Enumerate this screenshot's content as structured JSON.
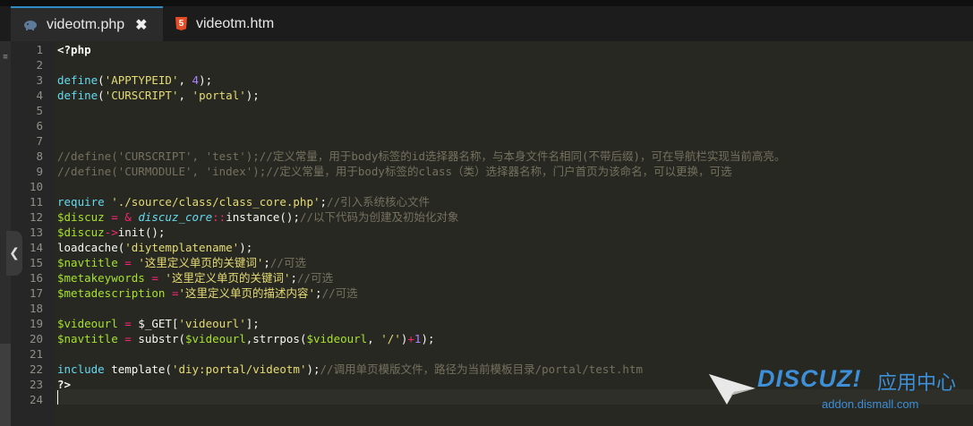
{
  "tabs": [
    {
      "label": "videotm.php",
      "icon": "php-elephant-icon",
      "active": true
    },
    {
      "label": "videotm.htm",
      "icon": "html5-icon",
      "active": false
    }
  ],
  "tab_close_symbol": "✖",
  "html5_letter": "5",
  "side_mark": "≡",
  "collapse_symbol": "❮",
  "line_numbers": [
    "1",
    "2",
    "3",
    "4",
    "5",
    "6",
    "7",
    "8",
    "9",
    "10",
    "11",
    "12",
    "13",
    "14",
    "15",
    "16",
    "17",
    "18",
    "19",
    "20",
    "21",
    "22",
    "23",
    "24"
  ],
  "code": [
    [
      {
        "t": "<?php",
        "c": "b"
      }
    ],
    [],
    [
      {
        "t": "define",
        "c": "kw"
      },
      {
        "t": "(",
        "c": "pl"
      },
      {
        "t": "'APPTYPEID'",
        "c": "str"
      },
      {
        "t": ", ",
        "c": "pl"
      },
      {
        "t": "4",
        "c": "num"
      },
      {
        "t": ");",
        "c": "pl"
      }
    ],
    [
      {
        "t": "define",
        "c": "kw"
      },
      {
        "t": "(",
        "c": "pl"
      },
      {
        "t": "'CURSCRIPT'",
        "c": "str"
      },
      {
        "t": ", ",
        "c": "pl"
      },
      {
        "t": "'portal'",
        "c": "str"
      },
      {
        "t": ");",
        "c": "pl"
      }
    ],
    [],
    [],
    [],
    [
      {
        "t": "//define('CURSCRIPT', 'test');//定义常量，用于body标签的id选择器名称，与本身文件名相同(不带后缀)，可在导航栏实现当前高亮。",
        "c": "cm"
      }
    ],
    [
      {
        "t": "//define('CURMODULE', 'index');//定义常量，用于body标签的class（类）选择器名称，门户首页为该命名，可以更换，可选",
        "c": "cm"
      }
    ],
    [],
    [
      {
        "t": "require",
        "c": "kw"
      },
      {
        "t": " ",
        "c": "pl"
      },
      {
        "t": "'./source/class/class_core.php'",
        "c": "str"
      },
      {
        "t": ";",
        "c": "pl"
      },
      {
        "t": "//引入系统核心文件",
        "c": "cm"
      }
    ],
    [
      {
        "t": "$discuz",
        "c": "var"
      },
      {
        "t": " = ",
        "c": "op"
      },
      {
        "t": "& ",
        "c": "op"
      },
      {
        "t": "discuz_core",
        "c": "it"
      },
      {
        "t": "::",
        "c": "op"
      },
      {
        "t": "instance();",
        "c": "pl"
      },
      {
        "t": "//以下代码为创建及初始化对象",
        "c": "cm"
      }
    ],
    [
      {
        "t": "$discuz",
        "c": "var"
      },
      {
        "t": "->",
        "c": "op"
      },
      {
        "t": "init();",
        "c": "pl"
      }
    ],
    [
      {
        "t": "loadcache(",
        "c": "pl"
      },
      {
        "t": "'diytemplatename'",
        "c": "str"
      },
      {
        "t": ");",
        "c": "pl"
      }
    ],
    [
      {
        "t": "$navtitle",
        "c": "var"
      },
      {
        "t": " = ",
        "c": "op"
      },
      {
        "t": "'这里定义单页的关键词'",
        "c": "str"
      },
      {
        "t": ";",
        "c": "pl"
      },
      {
        "t": "//可选",
        "c": "cm"
      }
    ],
    [
      {
        "t": "$metakeywords",
        "c": "var"
      },
      {
        "t": " = ",
        "c": "op"
      },
      {
        "t": "'这里定义单页的关键词'",
        "c": "str"
      },
      {
        "t": ";",
        "c": "pl"
      },
      {
        "t": "//可选",
        "c": "cm"
      }
    ],
    [
      {
        "t": "$metadescription",
        "c": "var"
      },
      {
        "t": " =",
        "c": "op"
      },
      {
        "t": "'这里定义单页的描述内容'",
        "c": "str"
      },
      {
        "t": ";",
        "c": "pl"
      },
      {
        "t": "//可选",
        "c": "cm"
      }
    ],
    [],
    [
      {
        "t": "$videourl",
        "c": "var"
      },
      {
        "t": " = ",
        "c": "op"
      },
      {
        "t": "$_GET[",
        "c": "pl"
      },
      {
        "t": "'videourl'",
        "c": "str"
      },
      {
        "t": "];",
        "c": "pl"
      }
    ],
    [
      {
        "t": "$navtitle",
        "c": "var"
      },
      {
        "t": " = ",
        "c": "op"
      },
      {
        "t": "substr(",
        "c": "pl"
      },
      {
        "t": "$videourl",
        "c": "var"
      },
      {
        "t": ",strrpos(",
        "c": "pl"
      },
      {
        "t": "$videourl",
        "c": "var"
      },
      {
        "t": ", ",
        "c": "pl"
      },
      {
        "t": "'/'",
        "c": "str"
      },
      {
        "t": ")",
        "c": "pl"
      },
      {
        "t": "+",
        "c": "op"
      },
      {
        "t": "1",
        "c": "num"
      },
      {
        "t": ");",
        "c": "pl"
      }
    ],
    [],
    [
      {
        "t": "include",
        "c": "kw"
      },
      {
        "t": " template(",
        "c": "pl"
      },
      {
        "t": "'diy:portal/videotm'",
        "c": "str"
      },
      {
        "t": ");",
        "c": "pl"
      },
      {
        "t": "//调用单页模版文件，路径为当前模板目录/portal/test.htm",
        "c": "cm"
      }
    ],
    [
      {
        "t": "?>",
        "c": "b"
      }
    ],
    []
  ],
  "watermark": {
    "brand": "DISCUZ!",
    "cn": "应用中心",
    "url": "addon.dismall.com",
    "color": "#3d8fd8"
  },
  "colors": {
    "background": "#272822",
    "tab_accent": "#2f8ec6",
    "keyword": "#66d9ef",
    "string": "#e6db74",
    "number": "#ae81ff",
    "variable": "#a6e22e",
    "operator": "#f92672",
    "comment": "#75715e"
  }
}
